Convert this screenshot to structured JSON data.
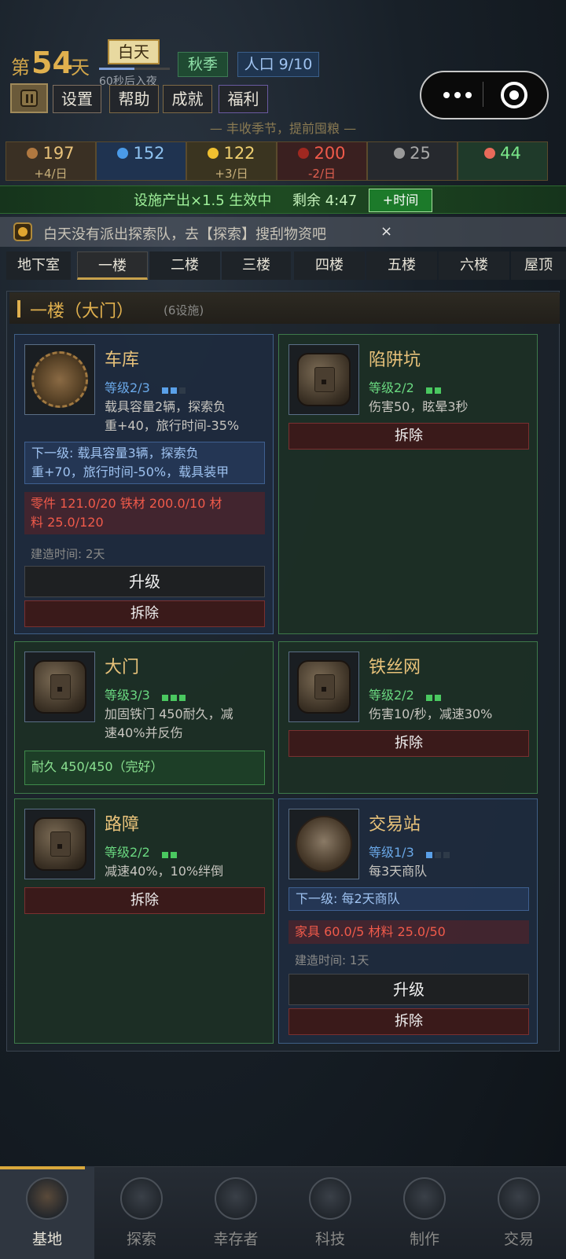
{
  "header": {
    "day_prefix": "第",
    "day_number": "54",
    "day_suffix": "天",
    "phase": "白天",
    "phase_progress": 0.5,
    "phase_timer": "60秒后入夜",
    "season": "秋季",
    "population": "人口 9/10",
    "buttons": {
      "settings": "设置",
      "help": "帮助",
      "achievements": "成就",
      "welfare": "福利"
    },
    "season_tip": "— 丰收季节，提前囤粮 —"
  },
  "resources": [
    {
      "icon": "food-icon",
      "value": "197",
      "rate": "+4/日",
      "color": "#e8c27a",
      "rate_color": "#c8b07a",
      "bg": "#3a3024",
      "ico_color": "#b07840"
    },
    {
      "icon": "water-icon",
      "value": "152",
      "rate": "",
      "color": "#8fc3f0",
      "rate_color": "#8fc3f0",
      "bg": "#1f3350",
      "ico_color": "#4a9ae8"
    },
    {
      "icon": "energy-icon",
      "value": "122",
      "rate": "+3/日",
      "color": "#f0d070",
      "rate_color": "#c8b07a",
      "bg": "#3a3420",
      "ico_color": "#f0c030"
    },
    {
      "icon": "fuel-icon",
      "value": "200",
      "rate": "-2/日",
      "color": "#f05a4a",
      "rate_color": "#e06050",
      "bg": "#3a2020",
      "ico_color": "#a02820"
    },
    {
      "icon": "parts-icon",
      "value": "25",
      "rate": "",
      "color": "#a8a8a8",
      "rate_color": "#a8a8a8",
      "bg": "#26292e",
      "ico_color": "#9a9a9a"
    },
    {
      "icon": "medicine-icon",
      "value": "44",
      "rate": "",
      "color": "#7ae88a",
      "rate_color": "#7ae88a",
      "bg": "#1f3a2a",
      "ico_color": "#e86a5a"
    }
  ],
  "boost": {
    "text": "设施产出×1.5 生效中",
    "remaining": "剩余 4:47",
    "button": "+时间"
  },
  "hint": {
    "text": "白天没有派出探索队，去【探索】搜刮物资吧",
    "close": "×"
  },
  "floor_tabs": [
    "地下室",
    "一楼",
    "二楼",
    "三楼",
    "四楼",
    "五楼",
    "六楼",
    "屋顶"
  ],
  "active_tab": 1,
  "floor": {
    "title": "一楼（大门）",
    "count": "(6设施)"
  },
  "facilities": {
    "garage": {
      "name": "车库",
      "level": "等级2/3",
      "level_current": 2,
      "level_max": 3,
      "desc_line1": "载具容量2辆，探索负",
      "desc_line2": "重+40，旅行时间-35%",
      "next_line1": "下一级: 载具容量3辆，探索负",
      "next_line2": "重+70，旅行时间-50%，载具装甲",
      "cost_line1": "零件 121.0/20  铁材 200.0/10  材",
      "cost_line2": "料 25.0/120",
      "build_time": "建造时间: 2天",
      "upgrade": "升级",
      "demolish": "拆除"
    },
    "pit_trap": {
      "name": "陷阱坑",
      "level": "等级2/2",
      "level_current": 2,
      "level_max": 2,
      "desc_line1": "伤害50，眩晕3秒",
      "demolish": "拆除"
    },
    "gate": {
      "name": "大门",
      "level": "等级3/3",
      "level_current": 3,
      "level_max": 3,
      "desc_line1": "加固铁门 450耐久，减",
      "desc_line2": "速40%并反伤",
      "durability": "耐久 450/450（完好）"
    },
    "barbed_wire": {
      "name": "铁丝网",
      "level": "等级2/2",
      "level_current": 2,
      "level_max": 2,
      "desc_line1": "伤害10/秒，减速30%",
      "demolish": "拆除"
    },
    "roadblock": {
      "name": "路障",
      "level": "等级2/2",
      "level_current": 2,
      "level_max": 2,
      "desc_line1": "减速40%，10%绊倒",
      "demolish": "拆除"
    },
    "trading_post": {
      "name": "交易站",
      "level": "等级1/3",
      "level_current": 1,
      "level_max": 3,
      "desc_line1": "每3天商队",
      "next_line1": "下一级: 每2天商队",
      "cost_line1": "家具 60.0/5  材料 25.0/50",
      "build_time": "建造时间: 1天",
      "upgrade": "升级",
      "demolish": "拆除"
    }
  },
  "bottom_nav": [
    {
      "label": "基地",
      "icon": "base-icon",
      "icon_color": "#5a4a3a"
    },
    {
      "label": "探索",
      "icon": "compass-icon",
      "icon_color": "#3a4048"
    },
    {
      "label": "幸存者",
      "icon": "survivors-icon",
      "icon_color": "#3a4048"
    },
    {
      "label": "科技",
      "icon": "tech-gear-icon",
      "icon_color": "#3a4048"
    },
    {
      "label": "制作",
      "icon": "crafting-icon",
      "icon_color": "#3a4048"
    },
    {
      "label": "交易",
      "icon": "trade-cycle-icon",
      "icon_color": "#3a4048"
    }
  ],
  "active_nav": 0
}
